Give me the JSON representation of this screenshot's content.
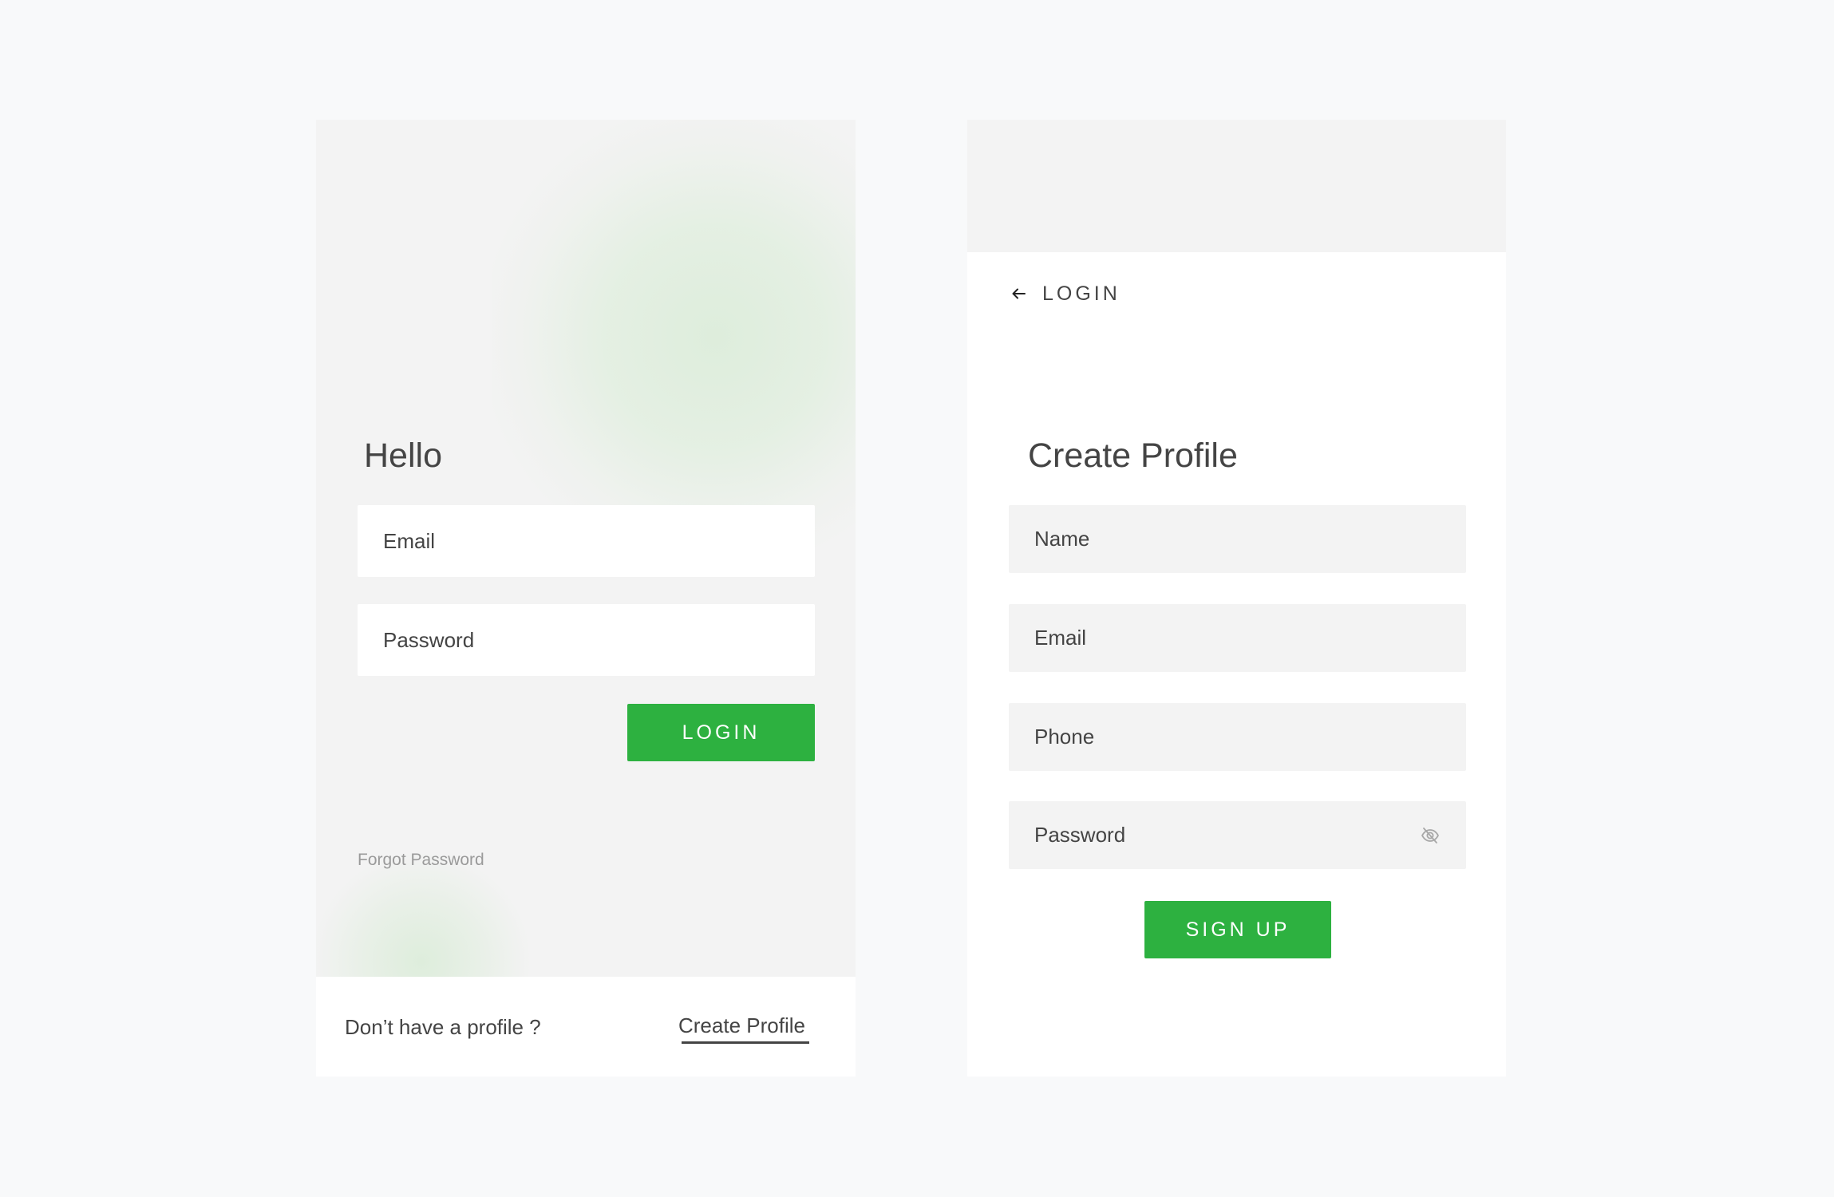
{
  "login": {
    "title": "Hello",
    "email_placeholder": "Email",
    "password_placeholder": "Password",
    "forgot_label": "Forgot Password",
    "login_button": "LOGIN",
    "no_profile_text": "Don’t have a profile ?",
    "create_profile_link": "Create Profile"
  },
  "signup": {
    "back_label": "LOGIN",
    "title": "Create Profile",
    "name_placeholder": "Name",
    "email_placeholder": "Email",
    "phone_placeholder": "Phone",
    "password_placeholder": "Password",
    "signup_button": "SIGN UP"
  },
  "icons": {
    "back": "arrow-left-icon",
    "password_toggle": "eye-off-icon"
  },
  "colors": {
    "page_background": "#f8f9fa",
    "panel_background": "#f3f3f3",
    "accent_green": "#2db140",
    "text": "#444444",
    "muted_text": "#9a9a9a"
  }
}
